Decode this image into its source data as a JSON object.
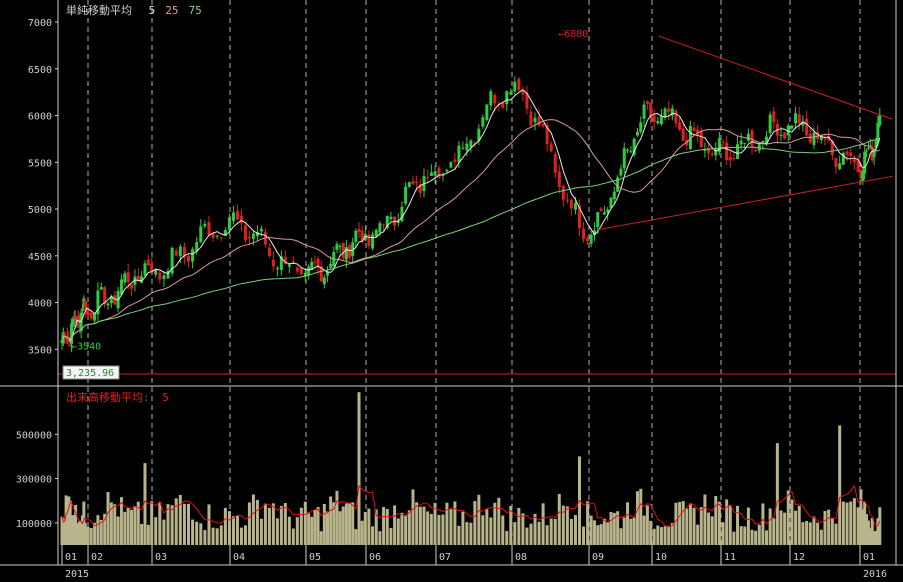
{
  "price_legend": {
    "label": "単純移動平均",
    "periods": [
      {
        "value": "5",
        "color": "#e0e0e0"
      },
      {
        "value": "25",
        "color": "#e89a9a"
      },
      {
        "value": "75",
        "color": "#8fd18f"
      }
    ]
  },
  "volume_legend": {
    "label": "出来高移動平均:",
    "period": "5"
  },
  "current_value_box": "3,235.96",
  "colors": {
    "background": "#000000",
    "up_candle": "#2ecc40",
    "down_candle": "#e02020",
    "ma5": "#e8e8e8",
    "ma25": "#d99a9a",
    "ma75": "#7fcf7f",
    "triangle": "#cc2020",
    "volume_bar": "#b8b48c",
    "volume_ma": "#e01010",
    "grid": "#cfcfcf",
    "value_box_text": "#2a8a2a"
  },
  "chart_data": [
    {
      "type": "candlestick",
      "title": "",
      "y_ticks": [
        3500,
        4000,
        4500,
        5000,
        5500,
        6000,
        6500,
        7000
      ],
      "ylim": [
        3150,
        7150
      ],
      "months": [
        "01",
        "02",
        "03",
        "04",
        "05",
        "06",
        "07",
        "08",
        "09",
        "10",
        "11",
        "12",
        "01"
      ],
      "years": [
        {
          "label": "2015",
          "month_index": 0
        },
        {
          "label": "2016",
          "month_index": 12
        }
      ],
      "monthly_closes": [
        3600,
        3950,
        4350,
        4850,
        4300,
        4700,
        5400,
        6300,
        4800,
        6000,
        5600,
        5900,
        5500
      ],
      "annotations": [
        {
          "label": "←6880",
          "value": 6880,
          "month": 7.6,
          "color": "#e02020"
        },
        {
          "label": "←3540",
          "value": 3540,
          "month": 0.35,
          "color": "#2ecc40"
        }
      ],
      "support_line": {
        "value": 3235.96
      },
      "triangle_lines": [
        {
          "from": {
            "month": 9.1,
            "value": 6850
          },
          "to": {
            "month": 12.9,
            "value": 5960
          }
        },
        {
          "from": {
            "month": 8.15,
            "value": 4780
          },
          "to": {
            "month": 12.9,
            "value": 5350
          }
        }
      ],
      "moving_averages": [
        "5",
        "25",
        "75"
      ]
    },
    {
      "type": "bar",
      "title": "",
      "y_ticks": [
        100000,
        300000,
        500000
      ],
      "ylim": [
        0,
        700000
      ],
      "notable_volumes": [
        {
          "month": 4.9,
          "value": 690000
        },
        {
          "month": 11.7,
          "value": 540000
        },
        {
          "month": 10.8,
          "value": 460000
        },
        {
          "month": 7.9,
          "value": 400000
        },
        {
          "month": 1.9,
          "value": 370000
        }
      ],
      "moving_average": "5"
    }
  ]
}
